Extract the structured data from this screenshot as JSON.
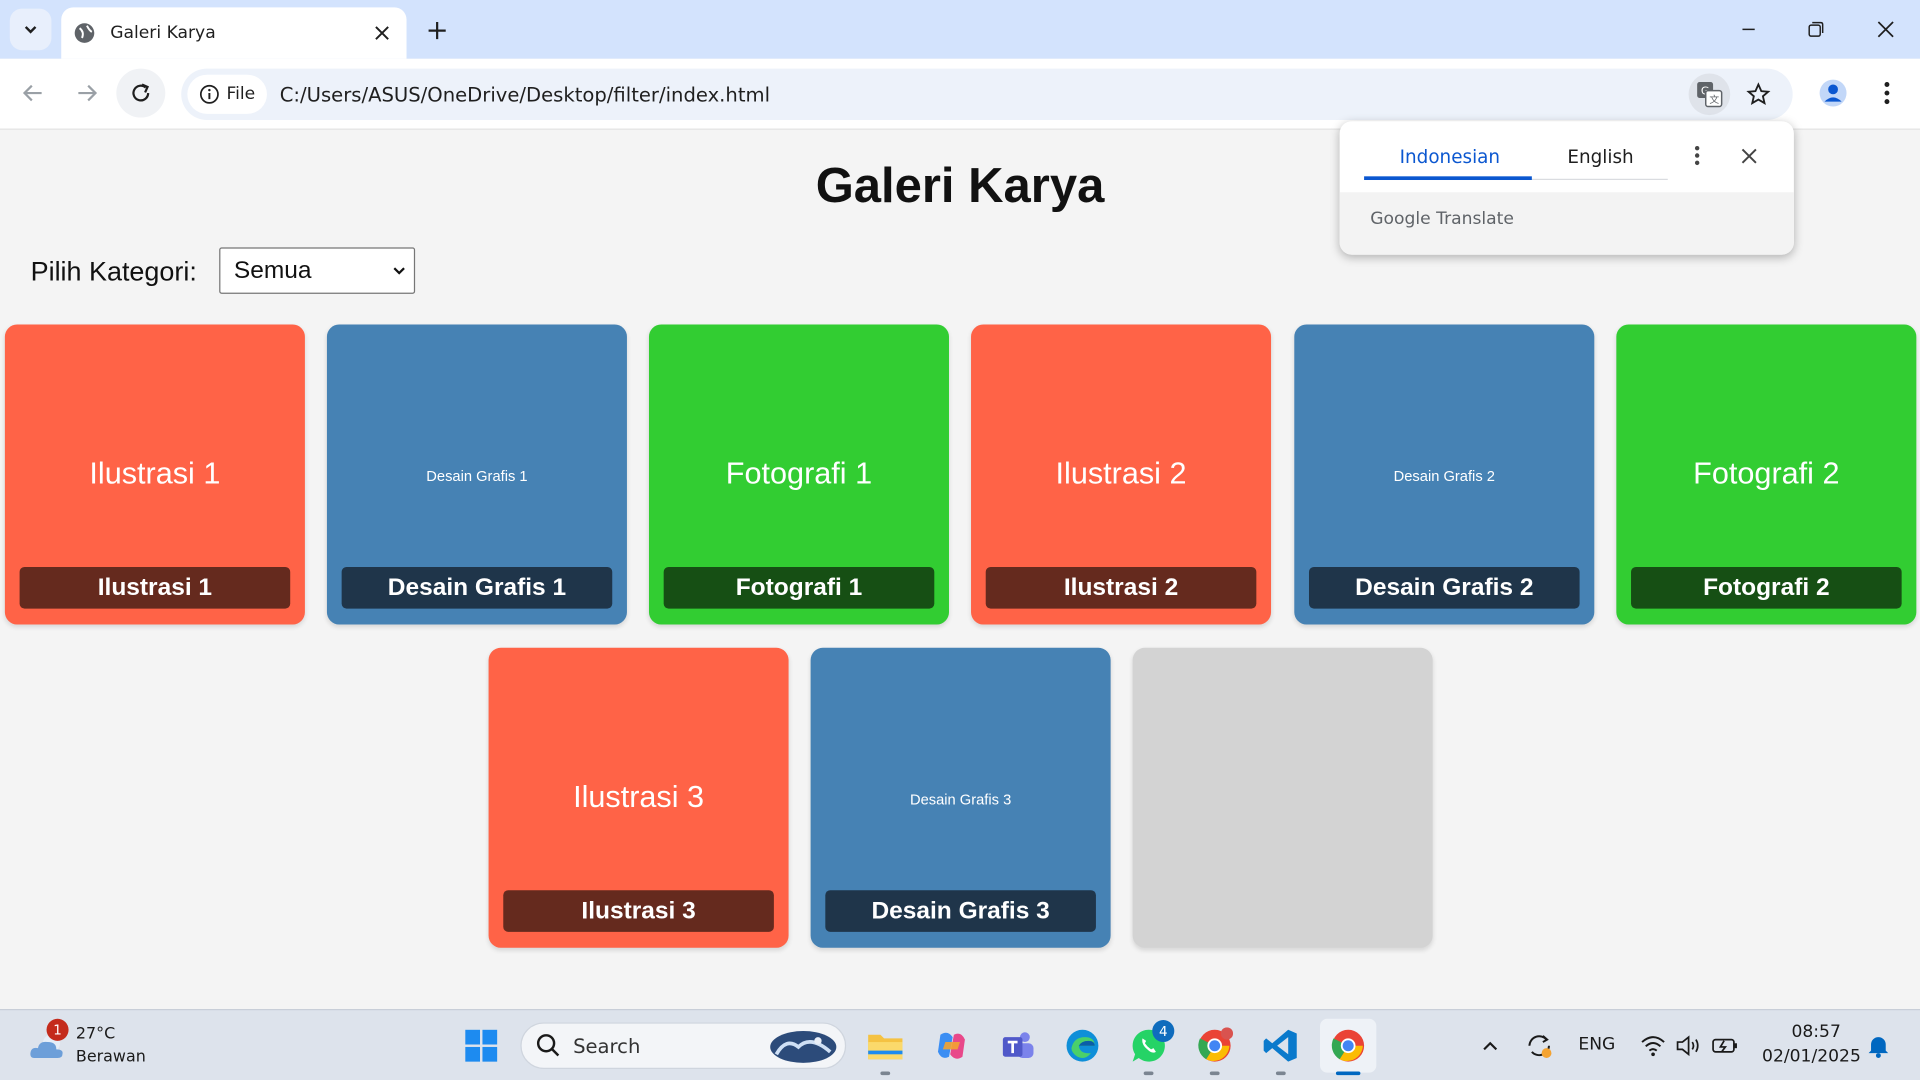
{
  "browser": {
    "tab_title": "Galeri Karya",
    "omnibox_chip": "File",
    "url": "C:/Users/ASUS/OneDrive/Desktop/filter/index.html"
  },
  "page": {
    "title": "Galeri Karya",
    "filter_label": "Pilih Kategori:",
    "filter_selected": "Semua"
  },
  "gallery": {
    "items": [
      {
        "image_text": "Ilustrasi 1",
        "caption": "Ilustrasi 1",
        "category": "ilustrasi"
      },
      {
        "image_text": "Desain Grafis 1",
        "caption": "Desain Grafis 1",
        "category": "desain"
      },
      {
        "image_text": "Fotografi 1",
        "caption": "Fotografi 1",
        "category": "fotografi"
      },
      {
        "image_text": "Ilustrasi 2",
        "caption": "Ilustrasi 2",
        "category": "ilustrasi"
      },
      {
        "image_text": "Desain Grafis 2",
        "caption": "Desain Grafis 2",
        "category": "desain"
      },
      {
        "image_text": "Fotografi 2",
        "caption": "Fotografi 2",
        "category": "fotografi"
      },
      {
        "image_text": "Ilustrasi 3",
        "caption": "Ilustrasi 3",
        "category": "ilustrasi"
      },
      {
        "image_text": "Desain Grafis 3",
        "caption": "Desain Grafis 3",
        "category": "desain"
      }
    ]
  },
  "translate_popup": {
    "tab_source": "Indonesian",
    "tab_target": "English",
    "brand": "Google Translate"
  },
  "taskbar": {
    "weather_temp": "27°C",
    "weather_desc": "Berawan",
    "weather_badge": "1",
    "search_placeholder": "Search",
    "whatsapp_badge": "4",
    "language": "ENG",
    "time": "08:57",
    "date": "02/01/2025"
  },
  "colors": {
    "ilustrasi": "#ff6347",
    "desain": "#4682b4",
    "fotografi": "#32cd32",
    "placeholder": "#d3d3d3",
    "accent": "#0b57d0"
  }
}
